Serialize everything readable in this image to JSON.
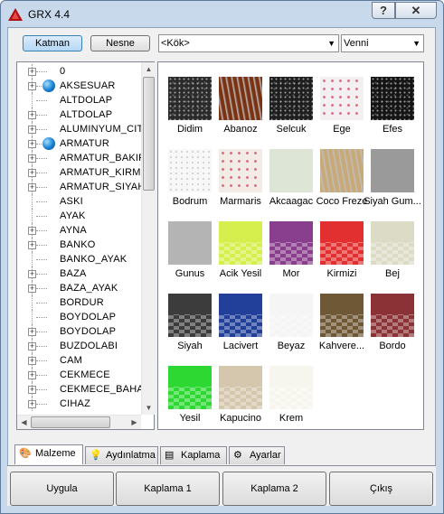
{
  "window": {
    "title": "GRX 4.4",
    "help_label": "?",
    "close_label": "✕"
  },
  "toolbar": {
    "layer_label": "Katman",
    "object_label": "Nesne",
    "root_dropdown": "<Kök>",
    "category_dropdown": "Venni"
  },
  "tree": {
    "items": [
      {
        "label": "0",
        "expand": "+",
        "globe": false
      },
      {
        "label": "AKSESUAR",
        "expand": "+",
        "globe": true
      },
      {
        "label": "ALTDOLAP",
        "expand": "",
        "globe": false
      },
      {
        "label": "ALTDOLAP",
        "expand": "+",
        "globe": false
      },
      {
        "label": "ALUMINYUM_CIT",
        "expand": "+",
        "globe": false
      },
      {
        "label": "ARMATUR",
        "expand": "+",
        "globe": true
      },
      {
        "label": "ARMATUR_BAKIR",
        "expand": "+",
        "globe": false
      },
      {
        "label": "ARMATUR_KIRMI",
        "expand": "+",
        "globe": false
      },
      {
        "label": "ARMATUR_SIYAH",
        "expand": "+",
        "globe": false
      },
      {
        "label": "ASKI",
        "expand": "",
        "globe": false
      },
      {
        "label": "AYAK",
        "expand": "",
        "globe": false
      },
      {
        "label": "AYNA",
        "expand": "+",
        "globe": false
      },
      {
        "label": "BANKO",
        "expand": "+",
        "globe": false
      },
      {
        "label": "BANKO_AYAK",
        "expand": "",
        "globe": false
      },
      {
        "label": "BAZA",
        "expand": "+",
        "globe": false
      },
      {
        "label": "BAZA_AYAK",
        "expand": "+",
        "globe": false
      },
      {
        "label": "BORDUR",
        "expand": "",
        "globe": false
      },
      {
        "label": "BOYDOLAP",
        "expand": "",
        "globe": false
      },
      {
        "label": "BOYDOLAP",
        "expand": "+",
        "globe": false
      },
      {
        "label": "BUZDOLABI",
        "expand": "+",
        "globe": false
      },
      {
        "label": "CAM",
        "expand": "+",
        "globe": false
      },
      {
        "label": "CEKMECE",
        "expand": "+",
        "globe": false
      },
      {
        "label": "CEKMECE_BAHAR",
        "expand": "+",
        "globe": false
      },
      {
        "label": "CIHAZ",
        "expand": "+",
        "globe": false
      }
    ]
  },
  "materials": [
    {
      "label": "Didim",
      "style": "speckle",
      "color": "#2a2a2a"
    },
    {
      "label": "Abanoz",
      "style": "wood",
      "color": "#7a3212"
    },
    {
      "label": "Selcuk",
      "style": "speckle",
      "color": "#1e1e1e"
    },
    {
      "label": "Ege",
      "style": "dots",
      "color": "#f4f0f2"
    },
    {
      "label": "Efes",
      "style": "speckle",
      "color": "#141414"
    },
    {
      "label": "Bodrum",
      "style": "light",
      "color": "#f7f7f7"
    },
    {
      "label": "Marmaris",
      "style": "dots",
      "color": "#f3ece6"
    },
    {
      "label": "Akcaagac",
      "style": "flat",
      "color": "#dde5d6"
    },
    {
      "label": "Coco Freze",
      "style": "wood",
      "color": "#c8a978"
    },
    {
      "label": "Siyah Gum...",
      "style": "flat",
      "color": "#9a9a9a"
    },
    {
      "label": "Gunus",
      "style": "flat",
      "color": "#b4b4b4"
    },
    {
      "label": "Acik Yesil",
      "style": "checker",
      "color": "#d6ef4d"
    },
    {
      "label": "Mor",
      "style": "checker",
      "color": "#8a3f8e"
    },
    {
      "label": "Kirmizi",
      "style": "checker",
      "color": "#e23030"
    },
    {
      "label": "Bej",
      "style": "checker",
      "color": "#dcdcc6"
    },
    {
      "label": "Siyah",
      "style": "checker",
      "color": "#3c3c3c"
    },
    {
      "label": "Lacivert",
      "style": "checker",
      "color": "#22409a"
    },
    {
      "label": "Beyaz",
      "style": "checker",
      "color": "#f5f5f5"
    },
    {
      "label": "Kahvere...",
      "style": "checker",
      "color": "#6e5836"
    },
    {
      "label": "Bordo",
      "style": "checker",
      "color": "#8a3236"
    },
    {
      "label": "Yesil",
      "style": "checker",
      "color": "#2ed832"
    },
    {
      "label": "Kapucino",
      "style": "checker",
      "color": "#d5c6ae"
    },
    {
      "label": "Krem",
      "style": "checker",
      "color": "#f7f6ee"
    }
  ],
  "tabs": [
    {
      "label": "Malzeme",
      "icon": "🎨"
    },
    {
      "label": "Aydınlatma",
      "icon": "💡"
    },
    {
      "label": "Kaplama",
      "icon": "▤"
    },
    {
      "label": "Ayarlar",
      "icon": "⚙"
    }
  ],
  "actions": {
    "apply_label": "Uygula",
    "coating1_label": "Kaplama 1",
    "coating2_label": "Kaplama 2",
    "exit_label": "Çıkış"
  }
}
